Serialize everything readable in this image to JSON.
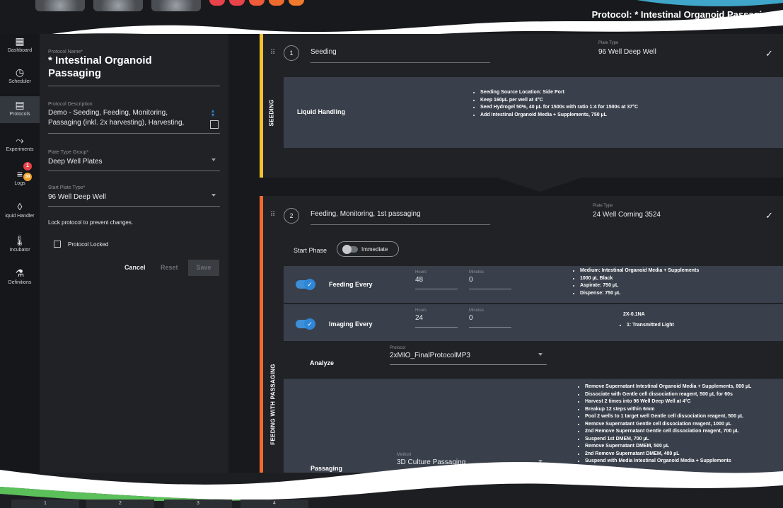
{
  "header": {
    "protocol_title": "Protocol: * Intestinal Organoid Passaging"
  },
  "colors": {
    "seeding_bar": "#f2c12e",
    "feeding_bar": "#ef6a2e",
    "accent": "#2f86d6",
    "card": "#3a404b",
    "dot_red": "#e8434a",
    "dot_orange": "#ef6a2e"
  },
  "sidebar": {
    "items": [
      {
        "label": "Dashboard",
        "icon": "dashboard-icon"
      },
      {
        "label": "Scheduler",
        "icon": "clock-icon"
      },
      {
        "label": "Protocols",
        "icon": "document-icon"
      },
      {
        "label": "Experiments",
        "icon": "experiments-icon"
      },
      {
        "label": "Logs",
        "icon": "list-icon"
      },
      {
        "label": "iquid Handler",
        "icon": "droplet-icon"
      },
      {
        "label": "Incubator",
        "icon": "thermometer-icon"
      },
      {
        "label": "Definitions",
        "icon": "flask-icon"
      }
    ],
    "logs_badge_red": "1",
    "logs_badge_orange": "38"
  },
  "form": {
    "name_label": "Protocol Name*",
    "name_line1": "* Intestinal Organoid",
    "name_line2": "Passaging",
    "desc_label": "Protocol Description",
    "desc_line1": "Demo - Seeding, Feeding, Monitoring,",
    "desc_line2": "Passaging (inkl. 2x harvesting), Harvesting,",
    "group_label": "Plate Type Group*",
    "group_value": "Deep Well Plates",
    "start_label": "Start Plate Type*",
    "start_value": "96 Well Deep Well",
    "lock_text": "Lock protocol to prevent changes.",
    "locked_label": "Protocol Locked",
    "cancel": "Cancel",
    "reset": "Reset",
    "save": "Save"
  },
  "phases": {
    "seeding": {
      "vertical_label": "SEEDING",
      "step_number": "1",
      "step_name": "Seeding",
      "plate_type_label": "Plate Type",
      "plate_type_value": "96 Well Deep Well",
      "card_title": "Liquid Handling",
      "bullets": [
        "Seeding Source Location: Side Port",
        "Keep 160µL per well at 4°C",
        "Seed Hydrogel 50%, 40 µL for 1500s with ratio 1:4 for 1500s at 37°C",
        "Add Intestinal Organoid Media + Supplements, 750 µL"
      ]
    },
    "feeding": {
      "vertical_label": "FEEDING WITH PASSAGING",
      "step_number": "2",
      "step_name": "Feeding, Monitoring, 1st passaging",
      "plate_type_label": "Plate Type",
      "plate_type_value": "24 Well Corning 3524",
      "start_phase_label": "Start Phase",
      "start_phase_value": "Immediate",
      "feeding": {
        "title": "Feeding Every",
        "hours_label": "Hours",
        "hours": "48",
        "minutes_label": "Minutes",
        "minutes": "0",
        "bullets": [
          "Medium: Intestinal Organoid Media + Supplements",
          "1000 µL Black",
          "Aspirate: 750 µL",
          "Dispense: 750 µL"
        ]
      },
      "imaging": {
        "title": "Imaging Every",
        "hours_label": "Hours",
        "hours": "24",
        "minutes_label": "Minutes",
        "minutes": "0",
        "objective": "2X-0.1NA",
        "bullets": [
          "1: Transmitted Light"
        ]
      },
      "analyze": {
        "title": "Analyze",
        "protocol_label": "Protocol",
        "protocol_value": "2xMIO_FinalProtocolMP3"
      },
      "passaging": {
        "title": "Passaging",
        "method_label": "Method",
        "method_value": "3D Culture Passaging",
        "bullets": [
          "Remove Supernatant Intestinal Organoid Media + Supplements, 800 µL",
          "Dissociate with Gentle cell dissociation reagent, 500 µL for 60s",
          "Harvest 2 times into 96 Well Deep Well at 4°C",
          "Breakup 12 steps within 6mm",
          "Pool 2 wells to 1 target well Gentle cell dissociation reagent, 500 µL",
          "Remove Supernatant Gentle cell dissociation reagent, 1000 µL",
          "2nd Remove Supernatant Gentle cell dissociation reagent, 700 µL",
          "Suspend 1st DMEM, 700 µL",
          "Remove Supernatant DMEM, 500 µL",
          "2nd Remove Supernatant DMEM, 400 µL",
          "Suspend with Media Intestinal Organoid Media + Supplements"
        ]
      }
    }
  },
  "bottom_tabs": [
    "1",
    "2",
    "3",
    "4"
  ]
}
